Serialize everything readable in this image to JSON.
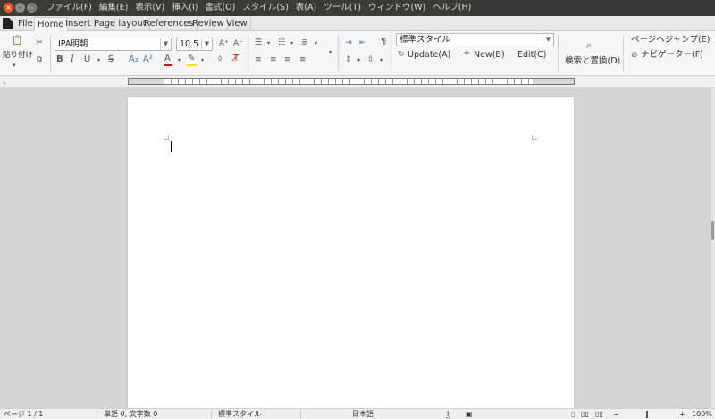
{
  "menubar": {
    "items": [
      "ファイル(F)",
      "編集(E)",
      "表示(V)",
      "挿入(I)",
      "書式(O)",
      "スタイル(S)",
      "表(A)",
      "ツール(T)",
      "ウィンドウ(W)",
      "ヘルプ(H)"
    ]
  },
  "tabs": [
    "File",
    "Home",
    "Insert",
    "Page layout",
    "References",
    "Review",
    "View"
  ],
  "active_tab": "Home",
  "clipboard": {
    "paste_label": "貼り付け"
  },
  "font": {
    "name": "IPA明朝",
    "size": "10.5"
  },
  "styles": {
    "current": "標準スタイル",
    "update": "Update(A)",
    "new": "New(B)",
    "edit": "Edit(C)"
  },
  "find": {
    "label": "検索と置換(D)"
  },
  "navigation": {
    "jump": "ページへジャンプ(E)",
    "navigator": "ナビゲーター(F)"
  },
  "status": {
    "page": "ページ 1 / 1",
    "words": "単語 0, 文字数 0",
    "style": "標準スタイル",
    "language": "日本語",
    "zoom": "100%"
  },
  "colors": {
    "titlebar": "#3c3b37",
    "close": "#e95420",
    "font_color": "#c01c28",
    "highlight": "#f5e50a"
  }
}
